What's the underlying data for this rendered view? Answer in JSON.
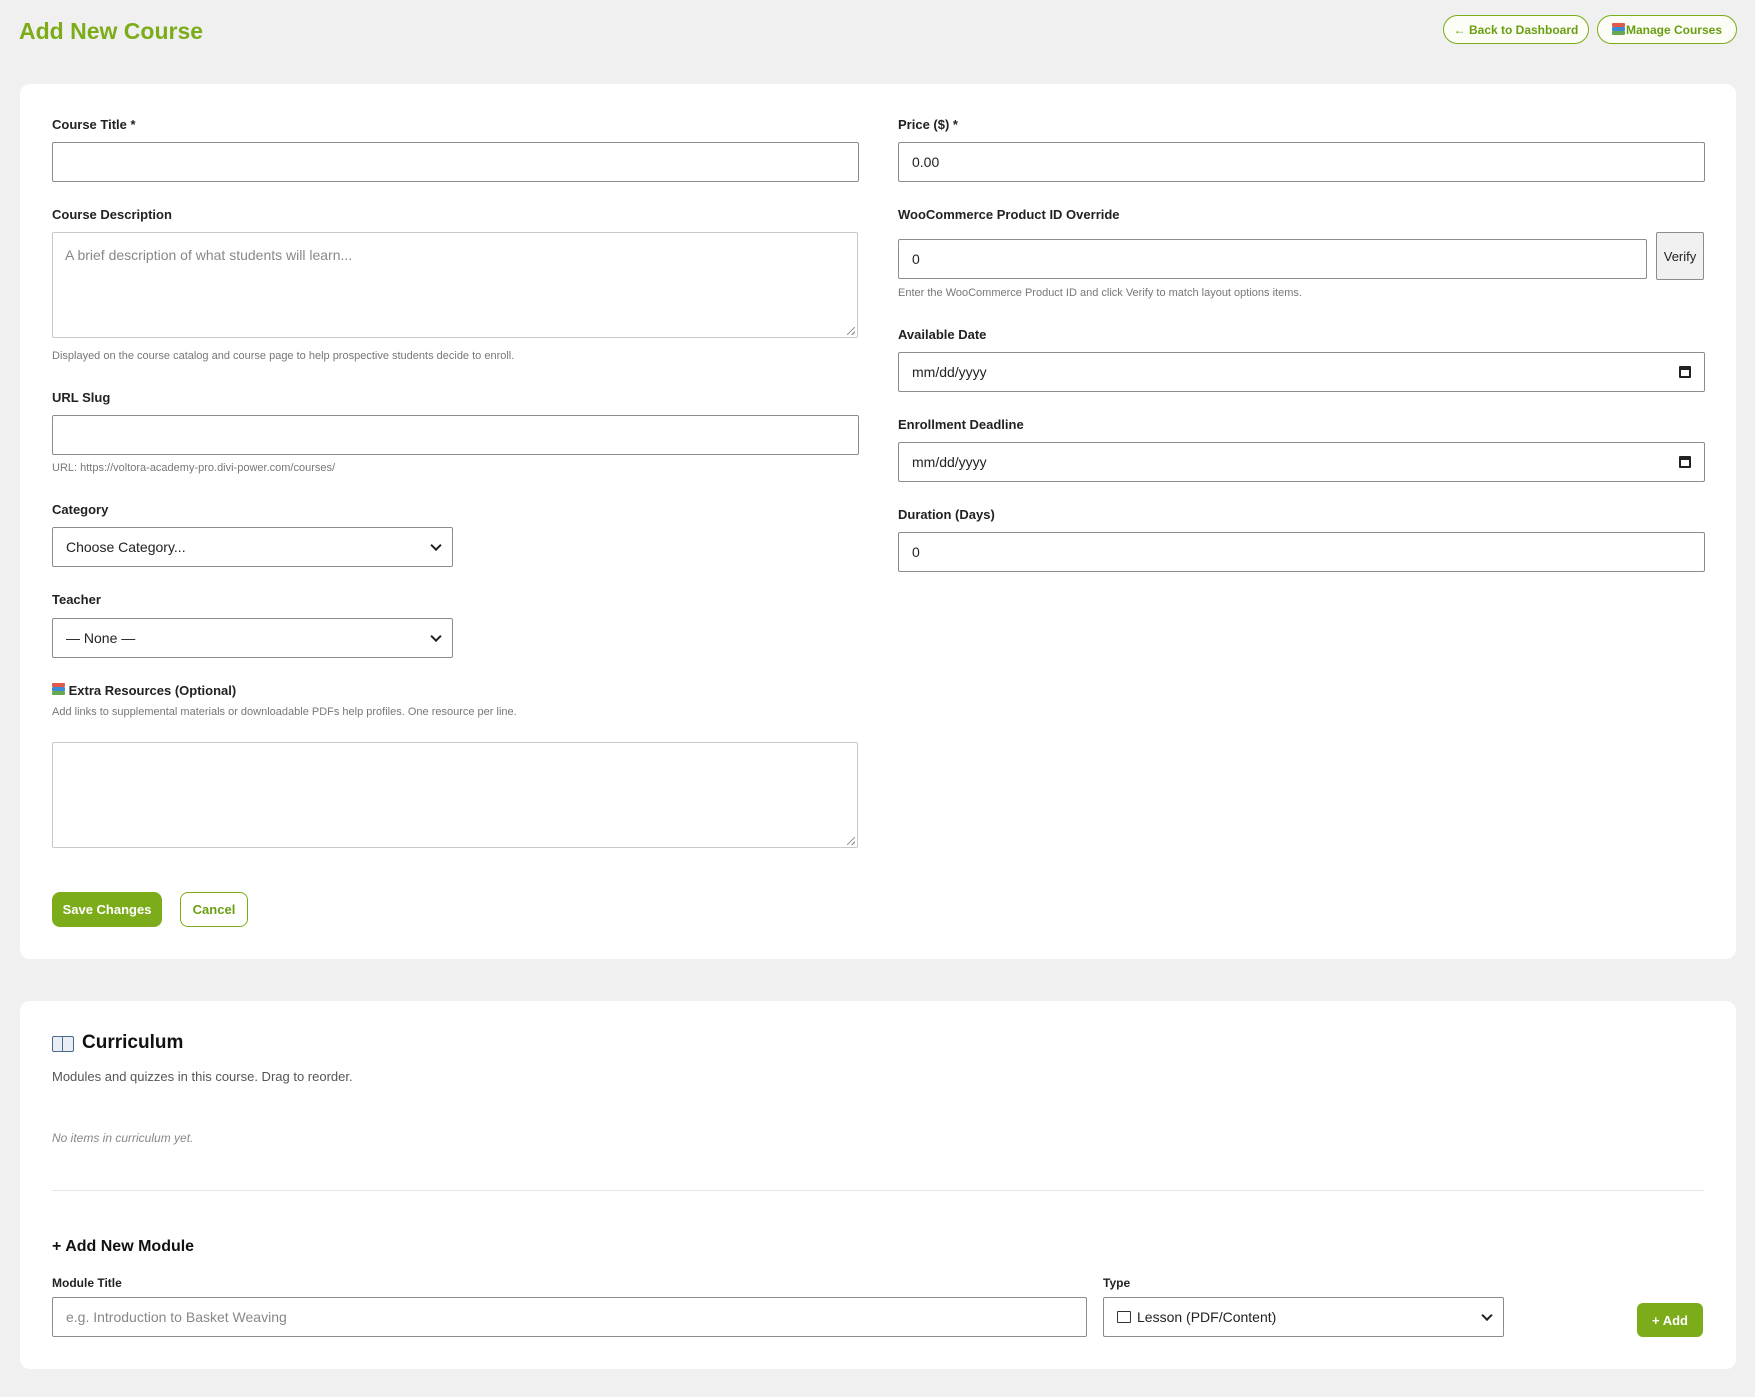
{
  "header": {
    "title": "Add New Course",
    "back_label": "← Back to Dashboard",
    "manage_label": "Manage Courses",
    "manage_icon": "books-icon"
  },
  "form": {
    "course_title": {
      "label": "Course Title *",
      "value": ""
    },
    "course_description": {
      "label": "Course Description",
      "placeholder": "A brief description of what students will learn...",
      "help": "Displayed on the course catalog and course page to help prospective students decide to enroll."
    },
    "url_slug": {
      "label": "URL Slug",
      "value": "",
      "help": "URL: https://voltora-academy-pro.divi-power.com/courses/"
    },
    "category": {
      "label": "Category",
      "selected": "Choose Category..."
    },
    "teacher": {
      "label": "Teacher",
      "selected": "— None —"
    },
    "extra_resources": {
      "label": "Extra Resources (Optional)",
      "help": "Add links to supplemental materials or downloadable PDFs help profiles. One resource per line.",
      "value": ""
    },
    "price": {
      "label": "Price ($) *",
      "value": "0.00"
    },
    "product_id": {
      "label": "WooCommerce Product ID Override",
      "value": "0",
      "verify_label": "Verify",
      "help": "Enter the WooCommerce Product ID and click Verify to match layout options items."
    },
    "available_date": {
      "label": "Available Date",
      "value": "mm/dd/yyyy"
    },
    "enrollment_deadline": {
      "label": "Enrollment Deadline",
      "value": "mm/dd/yyyy"
    },
    "duration": {
      "label": "Duration (Days)",
      "value": "0"
    },
    "save_label": "Save Changes",
    "cancel_label": "Cancel"
  },
  "curriculum": {
    "title": "Curriculum",
    "subtitle": "Modules and quizzes in this course. Drag to reorder.",
    "empty": "No items in curriculum yet.",
    "add_module_title": "+ Add New Module",
    "module_title_label": "Module Title",
    "module_title_placeholder": "e.g. Introduction to Basket Weaving",
    "type_label": "Type",
    "type_selected": "Lesson (PDF/Content)",
    "add_label": "+ Add"
  },
  "colors": {
    "accent": "#7cac1a",
    "background": "#f0f0f0",
    "card": "#ffffff"
  }
}
